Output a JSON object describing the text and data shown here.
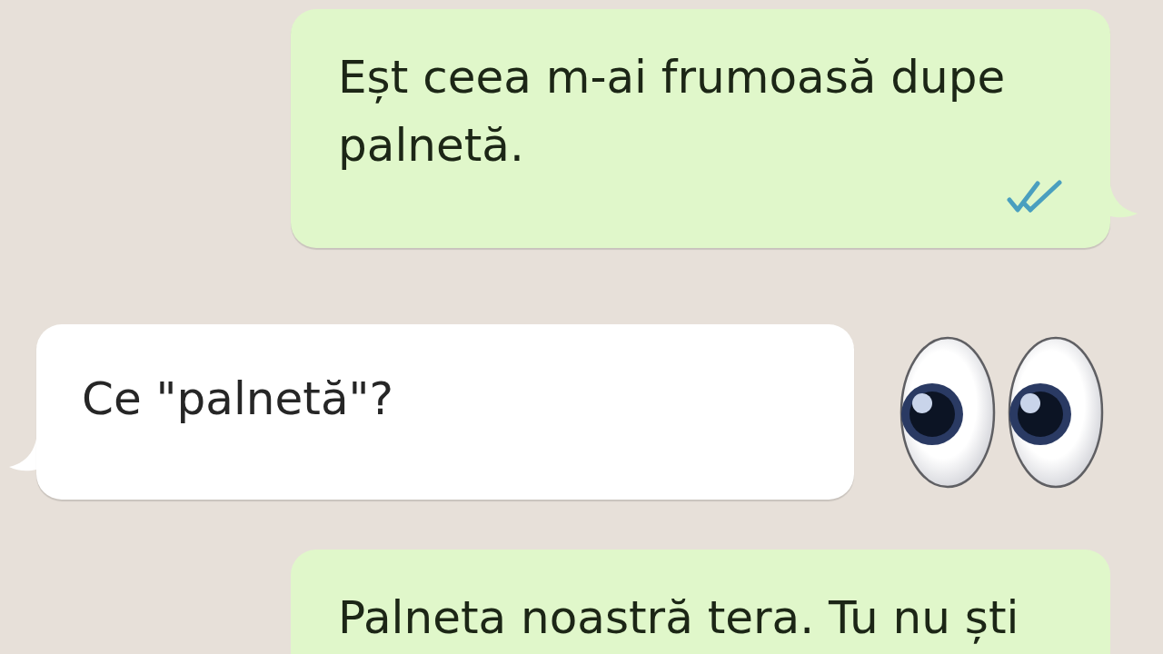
{
  "messages": [
    {
      "kind": "outgoing",
      "text": "Eșt ceea m-ai frumoasă dupe palnetă.",
      "read": true,
      "tail": true
    },
    {
      "kind": "incoming",
      "text": "Ce \"palnetă\"?",
      "tail": true,
      "side_emoji": true
    },
    {
      "kind": "outgoing",
      "text": "Palneta noastră tera. Tu nu ști",
      "tail": false
    }
  ]
}
